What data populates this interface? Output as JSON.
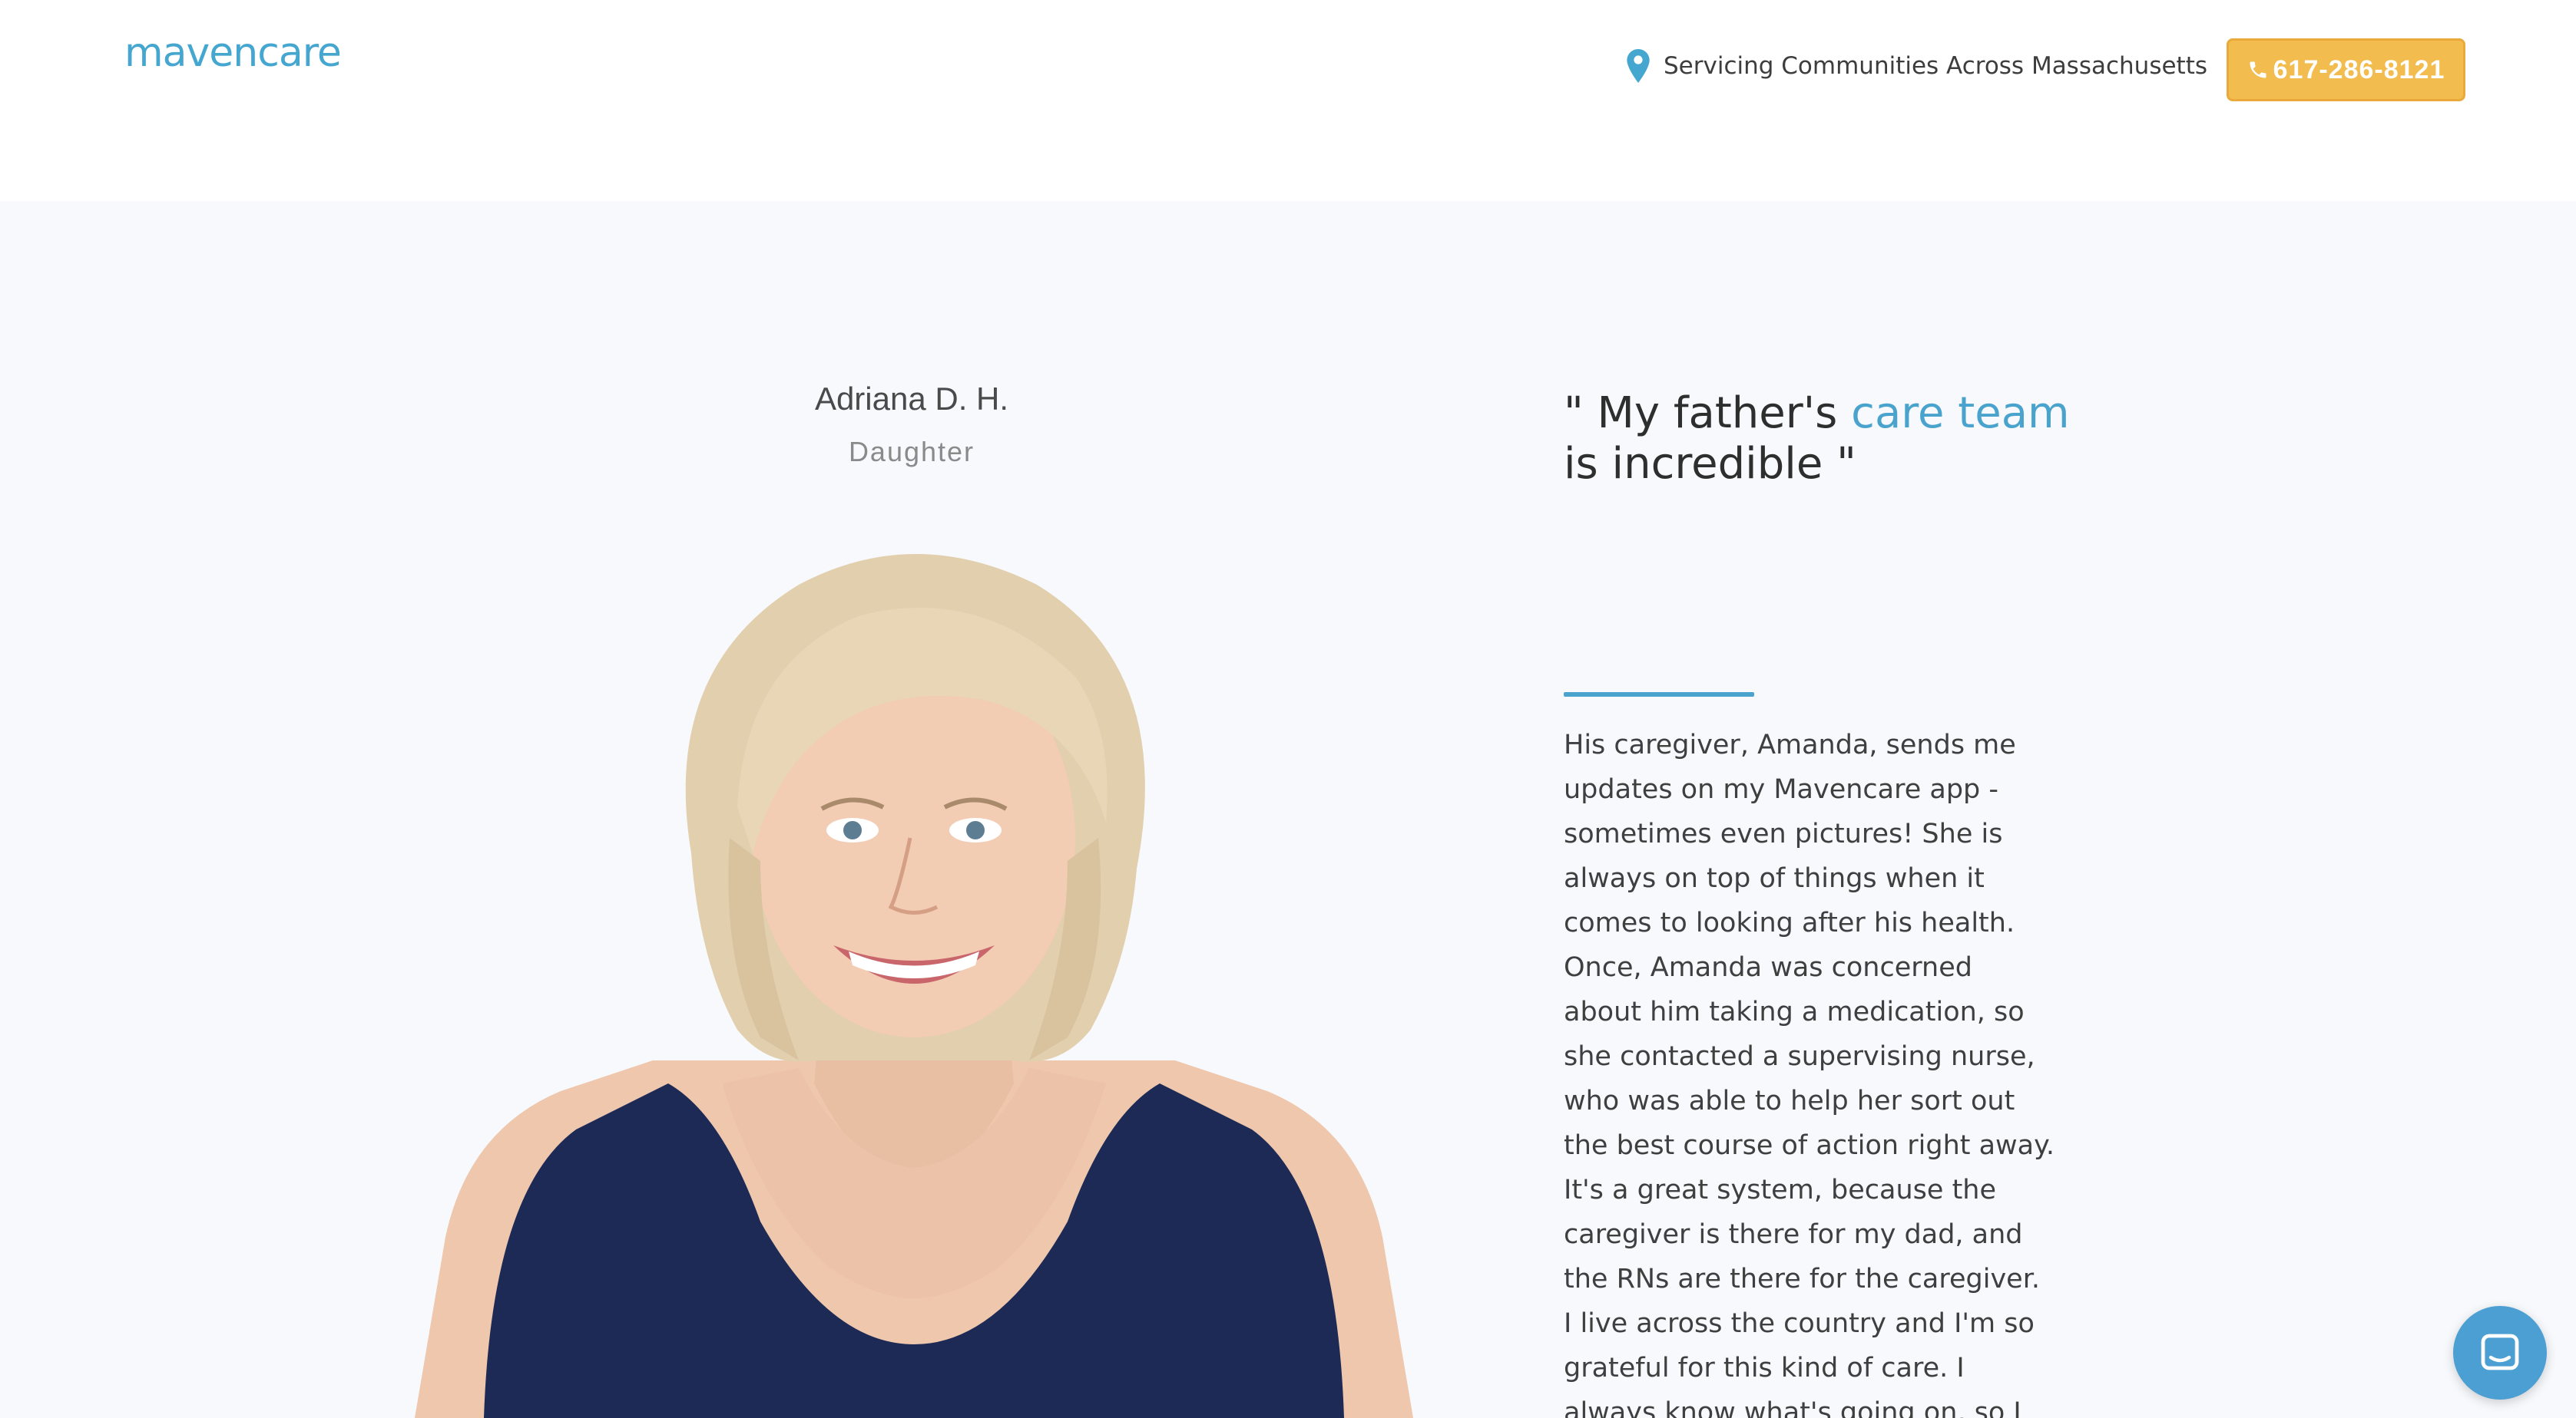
{
  "header": {
    "logo_text": "mavencare",
    "location_text": "Servicing Communities Across Massachusetts",
    "phone_label": "617-286-8121"
  },
  "testimonial": {
    "person_name": "Adriana D. H.",
    "person_role": "Daughter",
    "quote_open": "\" My father's ",
    "quote_accent": "care team",
    "quote_mid": " is ",
    "quote_underlined": "incredible",
    "quote_close": " \"",
    "body": "His caregiver, Amanda, sends me updates on my Mavencare app - sometimes even pictures! She is always on top of things when it comes to looking after his health. Once, Amanda was concerned about him taking a medication, so she contacted a supervising nurse, who was able to help her sort out the best course of action right away. It's a great system, because the caregiver is there for my dad, and the RNs are there for the caregiver. I live across the country and I'm so grateful for this kind of care. I always know what's going on, so I don't have to worry about my dad."
  },
  "icons": {
    "location": "map-pin-icon",
    "phone": "phone-icon",
    "chat": "chat-bubble-icon"
  },
  "colors": {
    "brand_blue": "#45a6cf",
    "accent_blue": "#4aa3cd",
    "phone_button": "#f3bc4f",
    "section_background": "#f7f9fc",
    "chat_launcher": "#4c9fd2"
  }
}
